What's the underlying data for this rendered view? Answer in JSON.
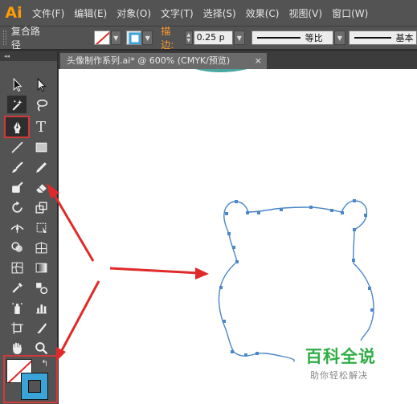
{
  "app": {
    "logo": "Ai"
  },
  "menu": [
    "文件(F)",
    "编辑(E)",
    "对象(O)",
    "文字(T)",
    "选择(S)",
    "效果(C)",
    "视图(V)",
    "窗口(W)"
  ],
  "control_bar": {
    "selection_label": "复合路径",
    "stroke_label": "描边:",
    "stroke_value": "0.25 p",
    "profile_label": "等比",
    "brush_label": "基本",
    "fill_icon": "none-swatch-icon",
    "stroke_swatch_color": "#3aa3d8"
  },
  "document": {
    "tab_title": "头像制作系列.ai* @ 600% (CMYK/预览)",
    "close_glyph": "×"
  },
  "toolbox": {
    "collapse_glyph": "◂◂",
    "type_tool_glyph": "T"
  },
  "colors": {
    "path_stroke": "#4a86c8",
    "annotation_red": "#e02a2a",
    "stroke_swatch": "#3aa3d8",
    "watermark_green": "#2fae45"
  },
  "watermark": {
    "title": "百科全说",
    "subtitle": "助你轻松解决"
  }
}
